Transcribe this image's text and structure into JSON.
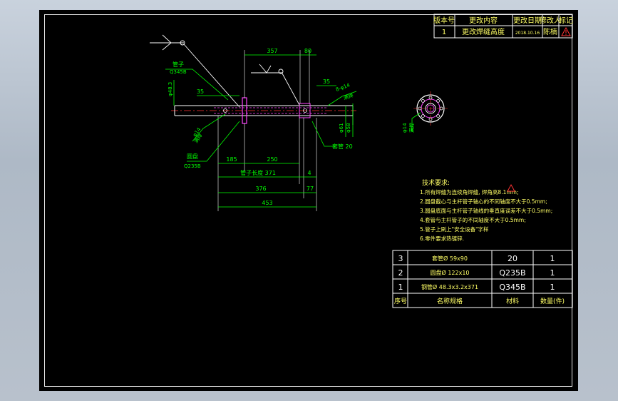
{
  "revision_table": {
    "headers": [
      "版本号",
      "更改内容",
      "更改日期",
      "修改人",
      "标记"
    ],
    "row": {
      "version": "1",
      "content": "更改焊缝高度",
      "date": "2018.10.16",
      "person": "陈楠"
    }
  },
  "dimensions": {
    "d357": "357",
    "d80": "80",
    "d35_left": "35",
    "d35_right": "35",
    "d48_3": "φ48.3",
    "d14_right": "8-φ14",
    "d14_left": "φ14",
    "d61": "φ61",
    "d58": "φ58",
    "d185": "185",
    "d250": "250",
    "pipe_length": "管子长度 371",
    "d4": "4",
    "d376": "376",
    "d77": "77",
    "d453": "453",
    "d14_section": "φ14"
  },
  "labels": {
    "pipe": "管子",
    "pipe_material": "Q345B",
    "disc": "圆盘",
    "disc_material": "Q235B",
    "sleeve": "套管 20",
    "weld_left": "满焊",
    "weld_right": "满焊",
    "weld_section": "满焊"
  },
  "tech_requirements": {
    "title": "技术要求:",
    "items": [
      "1.所有焊缝为连续角焊缝, 焊角高8.1mm;",
      "2.圆盘截心与主杆管子轴心的不同轴度不大于0.5mm;",
      "3.圆盘底面与主杆管子轴线的垂直度误差不大于0.5mm;",
      "4.套管与主杆管子的不同轴度不大于0.5mm;",
      "5.管子上刷上\"安全设备\"字样",
      "6.零件要求热镀锌."
    ]
  },
  "parts_table": {
    "headers": {
      "no": "序号",
      "name": "名称规格",
      "material": "材料",
      "qty": "数量(件)"
    },
    "rows": [
      {
        "no": "3",
        "name": "套管Ø 59x90",
        "material": "20",
        "qty": "1"
      },
      {
        "no": "2",
        "name": "圆盘Ø 122x10",
        "material": "Q235B",
        "qty": "1"
      },
      {
        "no": "1",
        "name": "钢管Ø 48.3x3.2x371",
        "material": "Q345B",
        "qty": "1"
      }
    ]
  }
}
